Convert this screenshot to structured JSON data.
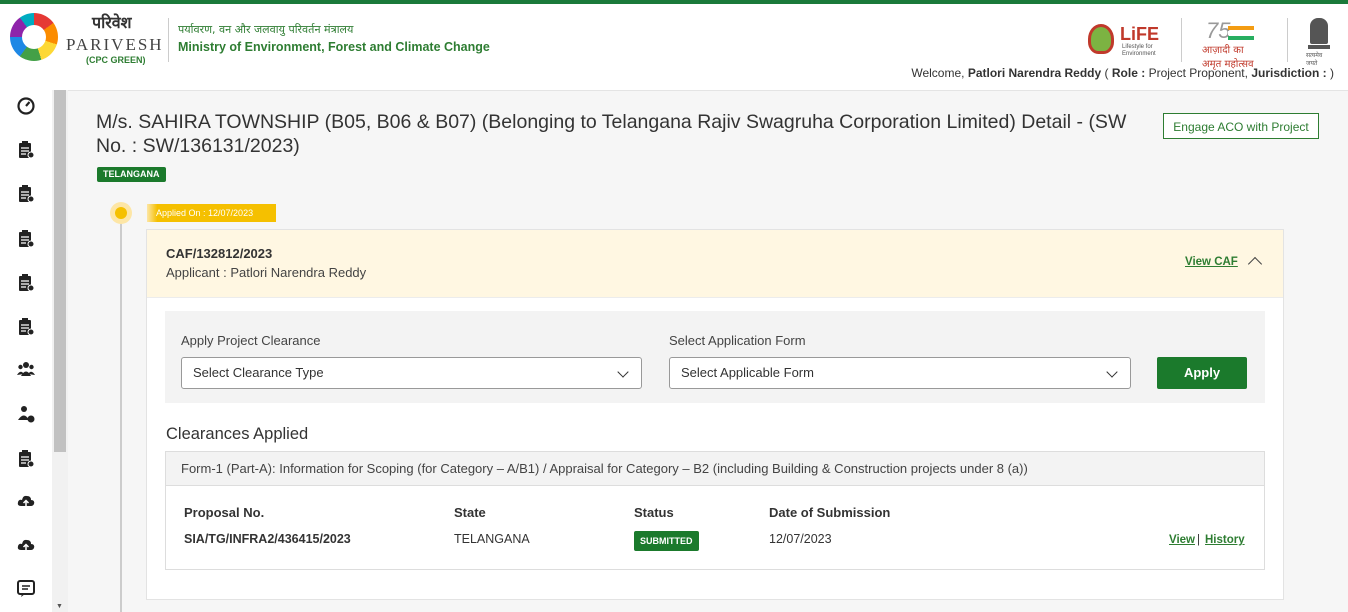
{
  "header": {
    "logo_hindi": "परिवेश",
    "logo_english": "PARIVESH",
    "logo_sub": "(CPC GREEN)",
    "ministry_hindi": "पर्यावरण, वन और जलवायु परिवर्तन मंत्रालय",
    "ministry_english": "Ministry of Environment, Forest and Climate Change",
    "life_label": "LiFE",
    "life_sub": "Lifestyle for Environment",
    "azadi_number": "75",
    "azadi_text": "आज़ादी का अमृत महोत्सव",
    "emblem_text": "सत्यमेव जयते",
    "welcome_prefix": "Welcome,",
    "user_name": "Patlori Narendra Reddy",
    "role_prefix": "( ",
    "role_label": "Role :",
    "role_value": "Project Proponent,",
    "jurisdiction_label": "Jurisdiction :",
    "jurisdiction_suffix": ")"
  },
  "sidebar": {
    "icons": [
      "dashboard-icon",
      "clipboard-icon",
      "clipboard-icon",
      "clipboard-icon",
      "clipboard-icon",
      "clipboard-icon",
      "users-icon",
      "user-check-icon",
      "clipboard-icon",
      "cloud-upload-icon",
      "cloud-upload-icon",
      "message-icon"
    ]
  },
  "page": {
    "title": "M/s. SAHIRA TOWNSHIP (B05, B06 & B07) (Belonging to Telangana Rajiv Swagruha Corporation Limited) Detail - (SW No. : SW/136131/2023)",
    "engage_button": "Engage ACO with Project",
    "state_badge": "TELANGANA",
    "applied_on": "Applied On : 12/07/2023"
  },
  "caf": {
    "number": "CAF/132812/2023",
    "applicant": "Applicant : Patlori Narendra Reddy",
    "view_link": "View CAF"
  },
  "apply_panel": {
    "clearance_label": "Apply Project Clearance",
    "clearance_value": "Select Clearance Type",
    "form_label": "Select Application Form",
    "form_value": "Select Applicable Form",
    "apply_button": "Apply"
  },
  "clearances": {
    "title": "Clearances Applied",
    "form_title": "Form-1 (Part-A): Information for Scoping (for Category – A/B1) / Appraisal for Category – B2 (including Building & Construction projects under 8 (a))",
    "columns": [
      "Proposal No.",
      "State",
      "Status",
      "Date of Submission"
    ],
    "row": {
      "proposal_no": "SIA/TG/INFRA2/436415/2023",
      "state": "TELANGANA",
      "status": "SUBMITTED",
      "date": "12/07/2023",
      "view_link": "View",
      "separator": "|",
      "history_link": "History"
    }
  },
  "colors": {
    "brand_green": "#1b7a2c",
    "accent_yellow": "#f5c000",
    "card_header_bg": "#fff7e2"
  }
}
